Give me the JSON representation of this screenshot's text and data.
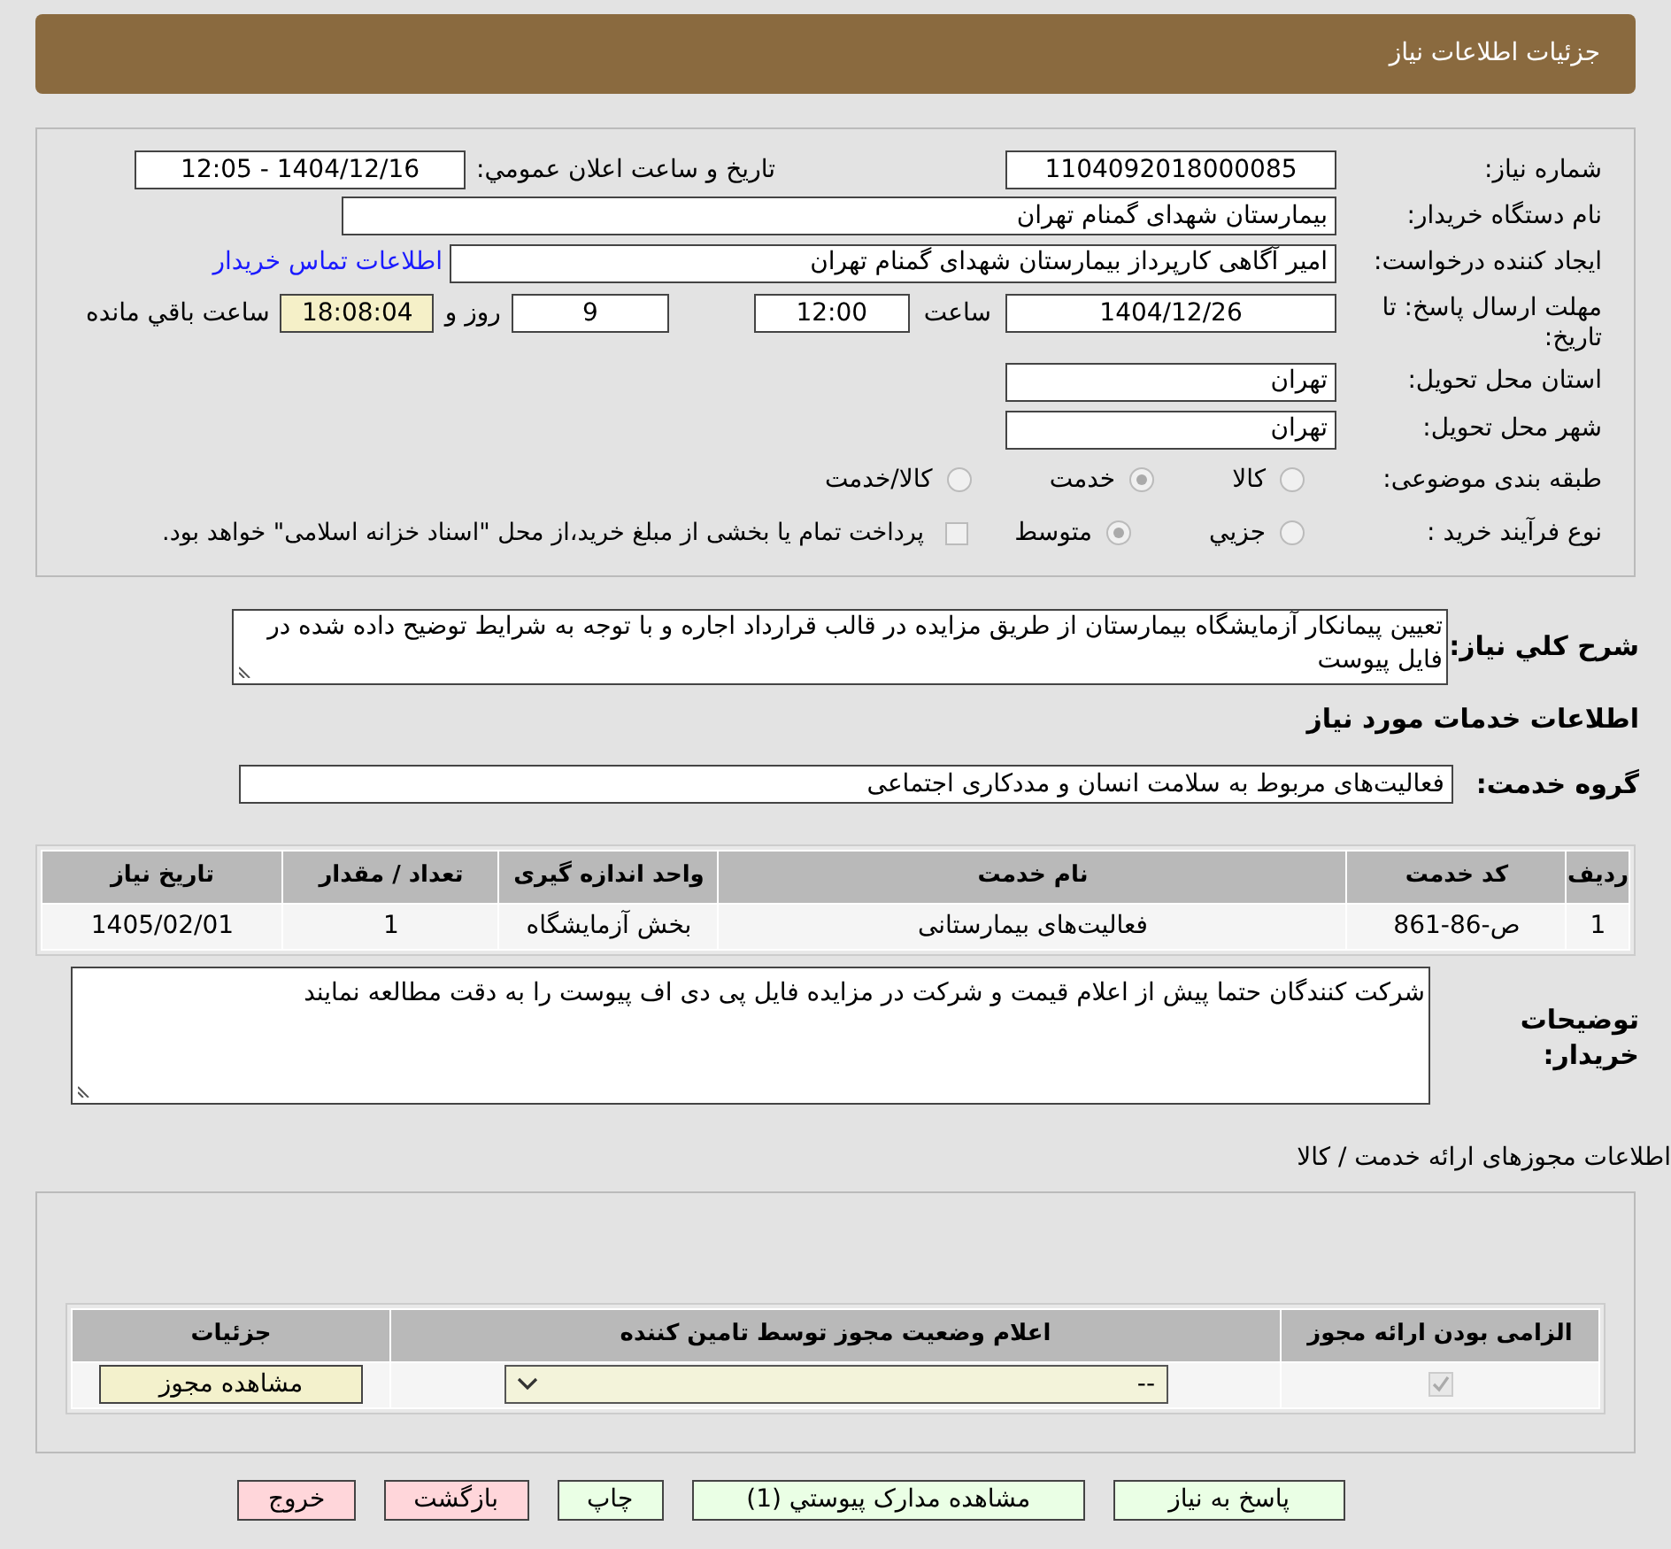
{
  "header": {
    "title": "جزئیات اطلاعات نیاز"
  },
  "need_number": {
    "label": "شماره نیاز:",
    "value": "1104092018000085"
  },
  "announce": {
    "label": "تاریخ و ساعت اعلان عمومي:",
    "value": "1404/12/16 - 12:05"
  },
  "buyer_org": {
    "label": "نام دستگاه خریدار:",
    "value": "بیمارستان شهدای گمنام تهران"
  },
  "requester": {
    "label": "ایجاد کننده درخواست:",
    "value": "امیر آگاهی کارپرداز بیمارستان شهدای گمنام تهران",
    "link": "اطلاعات تماس خریدار"
  },
  "deadline": {
    "label": "مهلت ارسال پاسخ: تا تاریخ:",
    "date": "1404/12/26",
    "time_label": "ساعت",
    "time": "12:00",
    "days": "9",
    "days_label": "روز و",
    "remaining": "18:08:04",
    "remaining_label": "ساعت باقي مانده"
  },
  "province": {
    "label": "استان محل تحویل:",
    "value": "تهران"
  },
  "city": {
    "label": "شهر محل تحویل:",
    "value": "تهران"
  },
  "category": {
    "label": "طبقه بندی موضوعی:",
    "options": [
      {
        "label": "کالا",
        "selected": false
      },
      {
        "label": "خدمت",
        "selected": true
      },
      {
        "label": "کالا/خدمت",
        "selected": false
      }
    ]
  },
  "process": {
    "label": "نوع فرآیند خرید :",
    "options": [
      {
        "label": "جزيي",
        "selected": false
      },
      {
        "label": "متوسط",
        "selected": true
      }
    ],
    "treasury": {
      "checked": false,
      "text": "پرداخت تمام یا بخشی از مبلغ خرید،از محل \"اسناد خزانه اسلامی\" خواهد بود."
    }
  },
  "description": {
    "label": "شرح کلي نیاز:",
    "value": "تعیین پیمانکار آزمایشگاه بیمارستان از طریق مزایده در قالب قرارداد اجاره و با توجه به شرایط توضیح داده شده در فایل پیوست"
  },
  "services_heading": "اطلاعات خدمات مورد نیاز",
  "service_group": {
    "label": "گروه خدمت:",
    "value": "فعالیت‌های مربوط به سلامت انسان و مددکاری اجتماعی"
  },
  "services_table": {
    "columns": [
      "ردیف",
      "کد خدمت",
      "نام خدمت",
      "واحد اندازه گیری",
      "تعداد / مقدار",
      "تاریخ نیاز"
    ],
    "rows": [
      [
        "1",
        "ص-86-861",
        "فعالیت‌های بیمارستانی",
        "بخش آزمایشگاه",
        "1",
        "1405/02/01"
      ]
    ]
  },
  "buyer_notes": {
    "label": "توضیحات خریدار:",
    "value": "شرکت کنندگان حتما پیش از اعلام قیمت و شرکت در مزایده فایل پی دی اف پیوست را به دقت مطالعه نمایند"
  },
  "permits": {
    "title": "اطلاعات مجوزهای ارائه خدمت / کالا",
    "columns": [
      "الزامی بودن ارائه مجوز",
      "اعلام وضعیت مجوز توسط تامین کننده",
      "جزئیات"
    ],
    "rows": [
      {
        "required": true,
        "status": "--",
        "button": "مشاهده مجوز"
      }
    ]
  },
  "buttons": [
    {
      "label": "پاسخ به نیاز",
      "kind": "primary"
    },
    {
      "label": "مشاهده مدارک پیوستي (1)",
      "kind": "primary"
    },
    {
      "label": "چاپ",
      "kind": "primary"
    },
    {
      "label": "بازگشت",
      "kind": "danger"
    },
    {
      "label": "خروج",
      "kind": "danger"
    }
  ]
}
